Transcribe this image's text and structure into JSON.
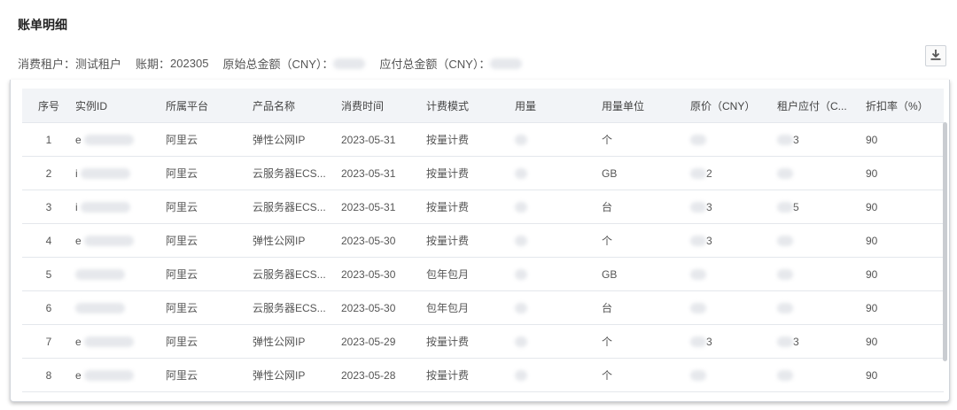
{
  "title": "账单明细",
  "summary": {
    "tenant_label": "消费租户：",
    "tenant_value": "测试租户",
    "period_label": "账期：",
    "period_value": "202305",
    "original_total_label": "原始总金额（CNY）：",
    "payable_total_label": "应付总金额（CNY）："
  },
  "download_icon": "download-icon",
  "table": {
    "headers": [
      "序号",
      "实例ID",
      "所属平台",
      "产品名称",
      "消费时间",
      "计费模式",
      "用量",
      "用量单位",
      "原价（CNY）",
      "租户应付（C...",
      "折扣率（%）"
    ],
    "rows": [
      {
        "index": "1",
        "platform": "阿里云",
        "product": "弹性公网IP",
        "time": "2023-05-31",
        "mode": "按量计费",
        "unit": "个",
        "discount": "90",
        "id_prefix": "e",
        "price_suffix": "",
        "pay_suffix": "3"
      },
      {
        "index": "2",
        "platform": "阿里云",
        "product": "云服务器ECS...",
        "time": "2023-05-31",
        "mode": "按量计费",
        "unit": "GB",
        "discount": "90",
        "id_prefix": "i",
        "price_suffix": "2",
        "pay_suffix": ""
      },
      {
        "index": "3",
        "platform": "阿里云",
        "product": "云服务器ECS...",
        "time": "2023-05-31",
        "mode": "按量计费",
        "unit": "台",
        "discount": "90",
        "id_prefix": "i",
        "price_suffix": "3",
        "pay_suffix": "5"
      },
      {
        "index": "4",
        "platform": "阿里云",
        "product": "弹性公网IP",
        "time": "2023-05-30",
        "mode": "按量计费",
        "unit": "个",
        "discount": "90",
        "id_prefix": "e",
        "price_suffix": "3",
        "pay_suffix": ""
      },
      {
        "index": "5",
        "platform": "阿里云",
        "product": "云服务器ECS...",
        "time": "2023-05-30",
        "mode": "包年包月",
        "unit": "GB",
        "discount": "90",
        "id_prefix": "",
        "price_suffix": "",
        "pay_suffix": ""
      },
      {
        "index": "6",
        "platform": "阿里云",
        "product": "云服务器ECS...",
        "time": "2023-05-30",
        "mode": "包年包月",
        "unit": "台",
        "discount": "90",
        "id_prefix": "",
        "price_suffix": "",
        "pay_suffix": ""
      },
      {
        "index": "7",
        "platform": "阿里云",
        "product": "弹性公网IP",
        "time": "2023-05-29",
        "mode": "按量计费",
        "unit": "个",
        "discount": "90",
        "id_prefix": "e",
        "price_suffix": "3",
        "pay_suffix": "3"
      },
      {
        "index": "8",
        "platform": "阿里云",
        "product": "弹性公网IP",
        "time": "2023-05-28",
        "mode": "按量计费",
        "unit": "个",
        "discount": "90",
        "id_prefix": "e",
        "price_suffix": "",
        "pay_suffix": ""
      }
    ]
  }
}
